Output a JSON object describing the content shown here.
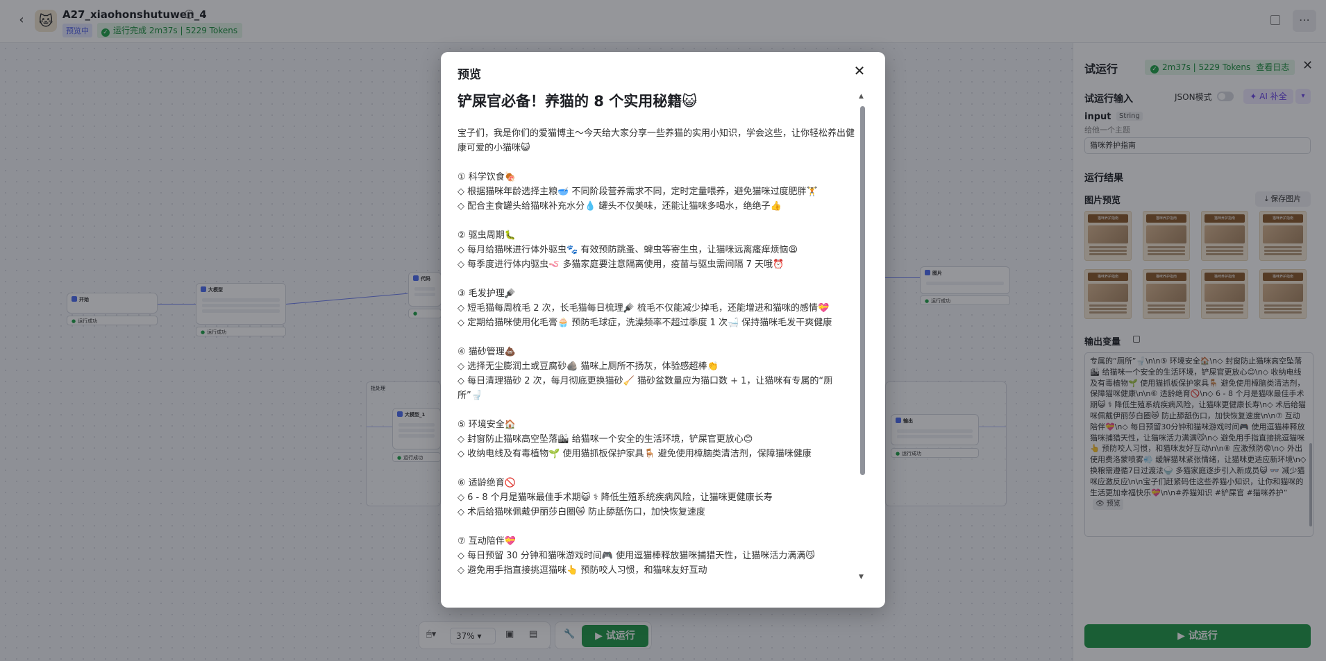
{
  "header": {
    "back_icon": "chevron-left-icon",
    "avatar_icon": "cat-avatar-icon",
    "app_title": "A27_xiaohonshutuwen_4",
    "preview_badge": "预览中",
    "run_status": "运行完成 2m37s | 5229 Tokens",
    "more_icon": "more-icon"
  },
  "canvas": {
    "nodes": {
      "start": "开始",
      "llm": "大模型",
      "code": "代码",
      "loop": "批处理",
      "llm1": "大模型_1",
      "image": "图片",
      "end": "输出"
    },
    "node_status": "运行成功",
    "toolbar": {
      "zoom": "37%",
      "run_label": "试运行"
    }
  },
  "panel": {
    "title": "试运行",
    "status": "2m37s | 5229 Tokens",
    "log_link": "查看日志",
    "input_section": "试运行输入",
    "json_mode": "JSON模式",
    "ai_button": "AI 补全",
    "input_name": "input",
    "input_type": "String",
    "input_desc": "给他一个主题",
    "input_value": "猫咪养护指南",
    "result_section": "运行结果",
    "image_preview": "图片预览",
    "save_image": "保存图片",
    "thumb_title": "猫咪养护指南",
    "output_label": "输出变量",
    "output_text": "专属的“厕所”🚽\\n\\n⑤ 环境安全🏠\\n◇ 封窗防止猫咪高空坠落🏙 给猫咪一个安全的生活环境，铲屎官更放心😊\\n◇ 收纳电线及有毒植物🌱 使用猫抓板保护家具🪑 避免使用樟脑类清洁剂，保障猫咪健康\\n\\n⑥ 适龄绝育🚫\\n◇ 6 - 8 个月是猫咪最佳手术期😺 ⚕ 降低生殖系统疾病风险，让猫咪更健康长寿\\n◇ 术后给猫咪佩戴伊丽莎白圈😿 防止舔舐伤口，加快恢复速度\\n\\n⑦ 互动陪伴💝\\n◇ 每日预留30分钟和猫咪游戏时间🎮 使用逗猫棒释放猫咪捕猎天性，让猫咪活力满满😼\\n◇ 避免用手指直接挑逗猫咪👆 预防咬人习惯，和猫咪友好互动\\n\\n⑧ 应激预防😨\\n◇ 外出使用费洛蒙喷雾💨 缓解猫咪紧张情绪，让猫咪更适应新环境\\n◇ 换粮需遵循7日过渡法🍚 多猫家庭逐步引入新成员😺 👓 减少猫咪应激反应\\n\\n宝子们赶紧码住这些养猫小知识，让你和猫咪的生活更加幸福快乐💝\\n\\n#养猫知识 #铲屎官 #猫咪养护”",
    "output_preview": "预览",
    "run_label": "试运行"
  },
  "modal": {
    "title": "预览",
    "close_icon": "close-icon",
    "post_title": "铲屎官必备！养猫的 8 个实用秘籍😺",
    "lines": [
      "宝子们，我是你们的爱猫博主～今天给大家分享一些养猫的实用小知识，学会这些，让你轻松养出健康可爱的小猫咪😺",
      "",
      "① 科学饮食🍖",
      "◇ 根据猫咪年龄选择主粮🥣 不同阶段营养需求不同，定时定量喂养，避免猫咪过度肥胖🏋",
      "◇ 配合主食罐头给猫咪补充水分💧 罐头不仅美味，还能让猫咪多喝水，绝绝子👍",
      "",
      "② 驱虫周期🐛",
      "◇ 每月给猫咪进行体外驱虫🐾 有效预防跳蚤、蜱虫等寄生虫，让猫咪远离瘙痒烦恼😩",
      "◇ 每季度进行体内驱虫🪱 多猫家庭要注意隔离使用，疫苗与驱虫需间隔 7 天哦⏰",
      "",
      "③ 毛发护理🪮",
      "◇ 短毛猫每周梳毛 2 次，长毛猫每日梳理🪮 梳毛不仅能减少掉毛，还能增进和猫咪的感情💝",
      "◇ 定期给猫咪使用化毛膏🧁 预防毛球症，洗澡频率不超过季度 1 次🛁 保持猫咪毛发干爽健康",
      "",
      "④ 猫砂管理💩",
      "◇ 选择无尘膨润土或豆腐砂🪨 猫咪上厕所不扬灰，体验感超棒👏",
      "◇ 每日清理猫砂 2 次，每月彻底更换猫砂🧹 猫砂盆数量应为猫口数 + 1，让猫咪有专属的“厕所”🚽",
      "",
      "⑤ 环境安全🏠",
      "◇ 封窗防止猫咪高空坠落🏙 给猫咪一个安全的生活环境，铲屎官更放心😊",
      "◇ 收纳电线及有毒植物🌱 使用猫抓板保护家具🪑 避免使用樟脑类清洁剂，保障猫咪健康",
      "",
      "⑥ 适龄绝育🚫",
      "◇ 6 - 8 个月是猫咪最佳手术期😺 ⚕ 降低生殖系统疾病风险，让猫咪更健康长寿",
      "◇ 术后给猫咪佩戴伊丽莎白圈😿 防止舔舐伤口，加快恢复速度",
      "",
      "⑦ 互动陪伴💝",
      "◇ 每日预留 30 分钟和猫咪游戏时间🎮 使用逗猫棒释放猫咪捕猎天性，让猫咪活力满满😼",
      "◇ 避免用手指直接挑逗猫咪👆 预防咬人习惯，和猫咪友好互动"
    ]
  }
}
